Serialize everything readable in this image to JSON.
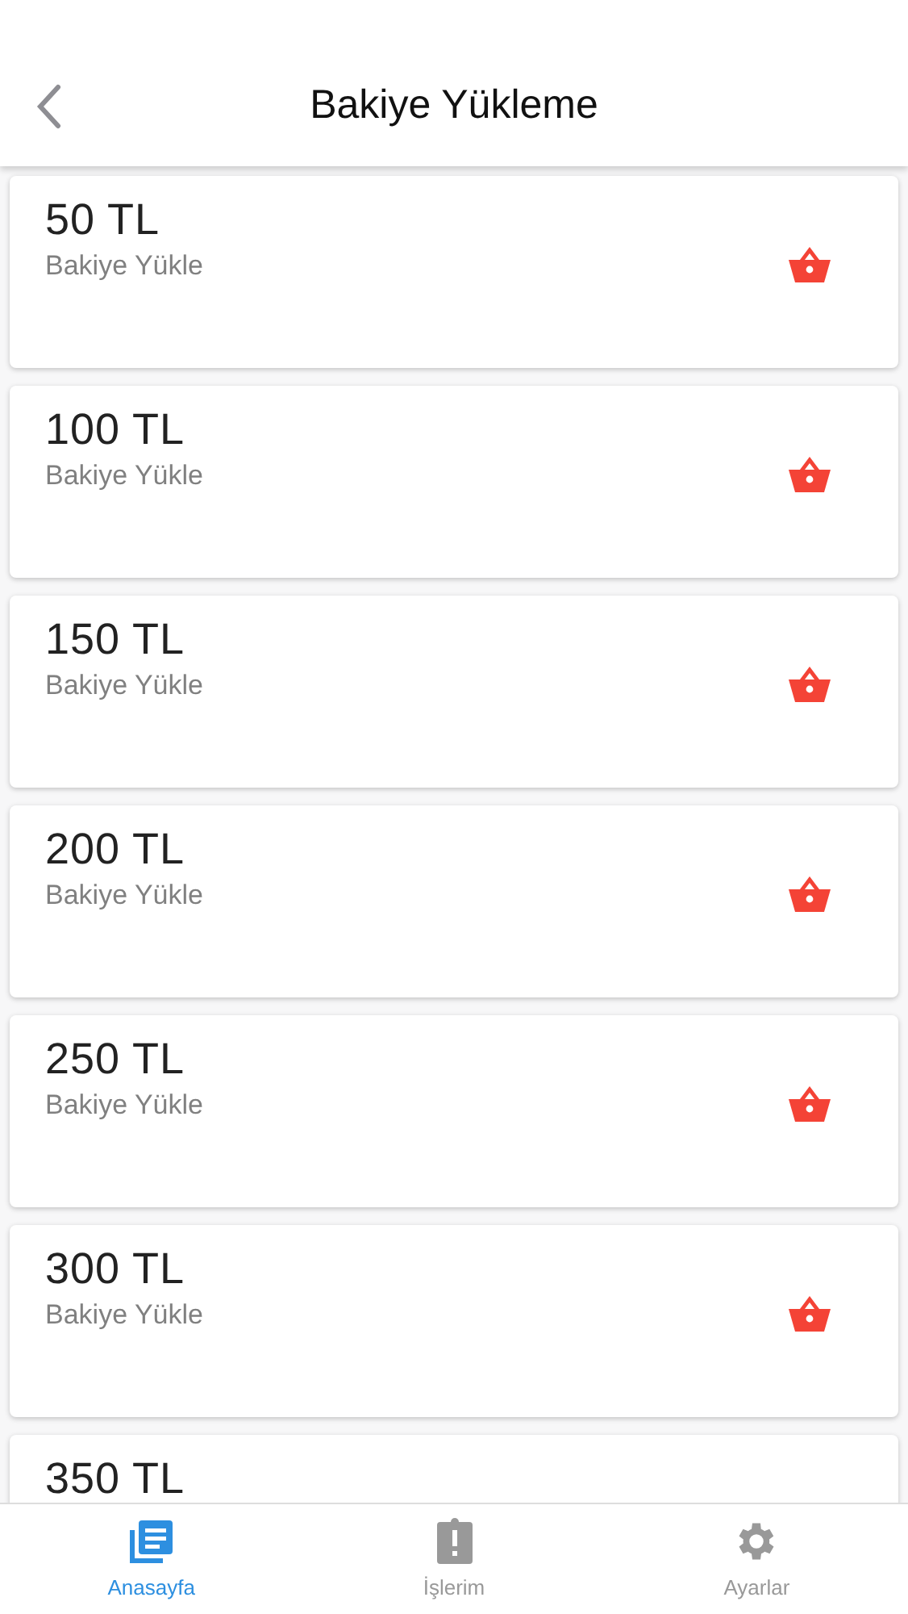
{
  "header": {
    "title": "Bakiye Yükleme"
  },
  "items": [
    {
      "kind": "full",
      "amount": "50 TL",
      "subtitle": "Bakiye Yükle"
    },
    {
      "kind": "full",
      "amount": "100 TL",
      "subtitle": "Bakiye Yükle"
    },
    {
      "kind": "full",
      "amount": "150 TL",
      "subtitle": "Bakiye Yükle"
    },
    {
      "kind": "full",
      "amount": "200 TL",
      "subtitle": "Bakiye Yükle"
    },
    {
      "kind": "full",
      "amount": "250 TL",
      "subtitle": "Bakiye Yükle"
    },
    {
      "kind": "full",
      "amount": "300 TL",
      "subtitle": "Bakiye Yükle"
    },
    {
      "kind": "cut",
      "amount": "350 TL"
    }
  ],
  "tabs": [
    {
      "label": "Anasayfa",
      "selected": true
    },
    {
      "label": "İşlerim",
      "selected": false
    },
    {
      "label": "Ayarlar",
      "selected": false
    }
  ]
}
